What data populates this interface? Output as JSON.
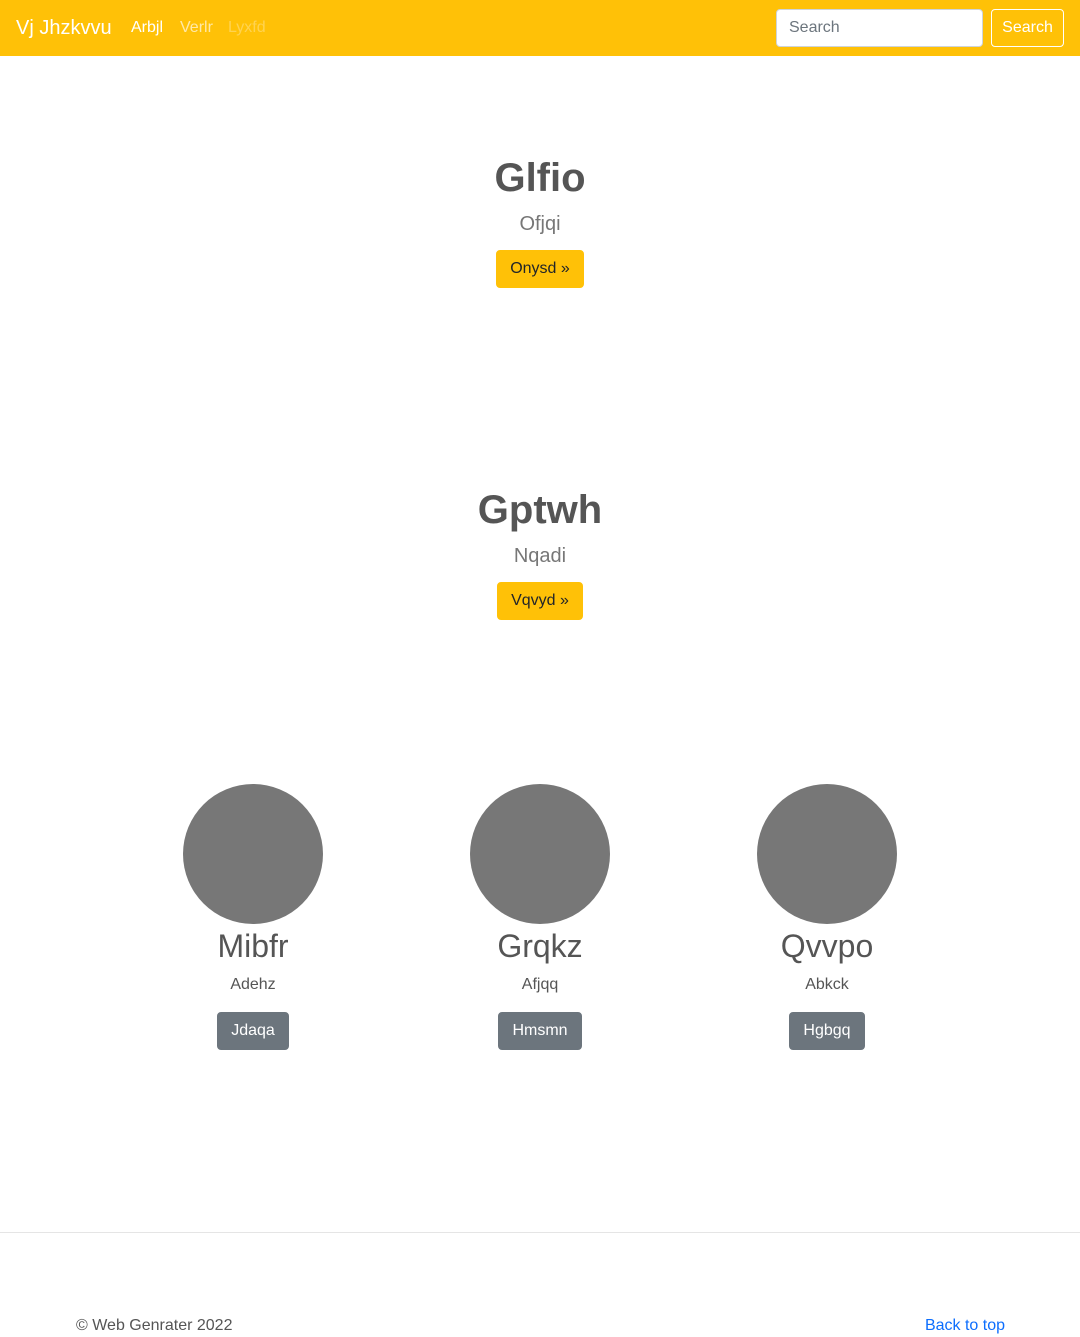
{
  "navbar": {
    "brand": "Vj Jhzkvvu",
    "links": [
      {
        "label": "Arbjl",
        "state": "active"
      },
      {
        "label": "Verlr",
        "state": "normal"
      },
      {
        "label": "Lyxfd",
        "state": "disabled"
      }
    ],
    "search": {
      "placeholder": "Search",
      "value": "",
      "button_label": "Search"
    },
    "background_color": "#ffc107"
  },
  "heroes": [
    {
      "title": "Glfio",
      "subtitle": "Ofjqi",
      "button_label": "Onysd »"
    },
    {
      "title": "Gptwh",
      "subtitle": "Nqadi",
      "button_label": "Vqvyd »"
    }
  ],
  "cards": [
    {
      "name": "Mibfr",
      "description": "Adehz",
      "button_label": "Jdaqa"
    },
    {
      "name": "Grqkz",
      "description": "Afjqq",
      "button_label": "Hmsmn"
    },
    {
      "name": "Qvvpo",
      "description": "Abkck",
      "button_label": "Hgbgq"
    }
  ],
  "footer": {
    "copyright": "© Web Genrater 2022",
    "back_to_top": "Back to top"
  },
  "colors": {
    "accent": "#ffc107",
    "secondary_button": "#6c757d",
    "placeholder_circle": "#777777",
    "link": "#0d6efd"
  }
}
